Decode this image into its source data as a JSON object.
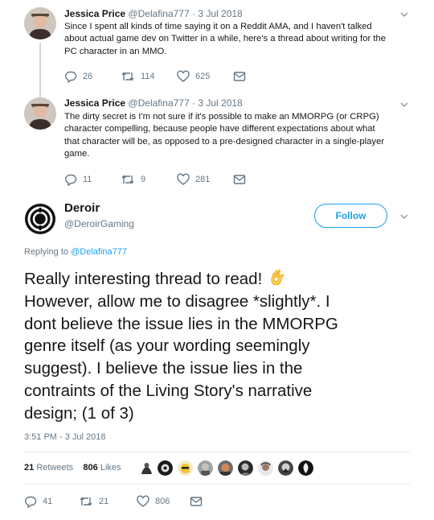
{
  "tweets": [
    {
      "author": "Jessica Price",
      "handle": "@Delafina777",
      "date": "3 Jul 2018",
      "text_lines": [
        "Since I spent all kinds of time saying it on a Reddit AMA, and I haven't talked",
        "about actual game dev on Twitter in a while, here's a thread about writing for the",
        "PC character in an MMO."
      ],
      "replies": "26",
      "retweets": "114",
      "likes": "625"
    },
    {
      "author": "Jessica Price",
      "handle": "@Delafina777",
      "date": "3 Jul 2018",
      "text_lines": [
        "The dirty secret is I'm not sure if it's possible to make an MMORPG (or CRPG)",
        "character compelling, because people have different expectations about what",
        "that character will be, as opposed to a pre-designed character in a single-player",
        "game."
      ],
      "replies": "11",
      "retweets": "9",
      "likes": "281"
    }
  ],
  "main_tweet": {
    "author": "Deroir",
    "handle": "@DeroirGaming",
    "follow_label": "Follow",
    "replying_label": "Replying to",
    "replying_handle": "@Delafina777",
    "text_lines": [
      "Really interesting thread to read!",
      "However, allow me to disagree *slightly*. I",
      "dont believe the issue lies in the MMORPG",
      "genre itself (as your wording seemingly",
      "suggest). I believe the issue lies in the",
      "contraints of the Living Story's narrative",
      "design; (1 of 3)"
    ],
    "timestamp": "3:51 PM - 3 Jul 2018",
    "retweet_count": "21",
    "retweet_label": "Retweets",
    "like_count": "806",
    "like_label": "Likes",
    "replies": "41",
    "retweets": "21",
    "likes": "806"
  },
  "colors": {
    "link_blue": "#1da1f2",
    "secondary_gray": "#657786",
    "divider": "#e6ecf0"
  }
}
